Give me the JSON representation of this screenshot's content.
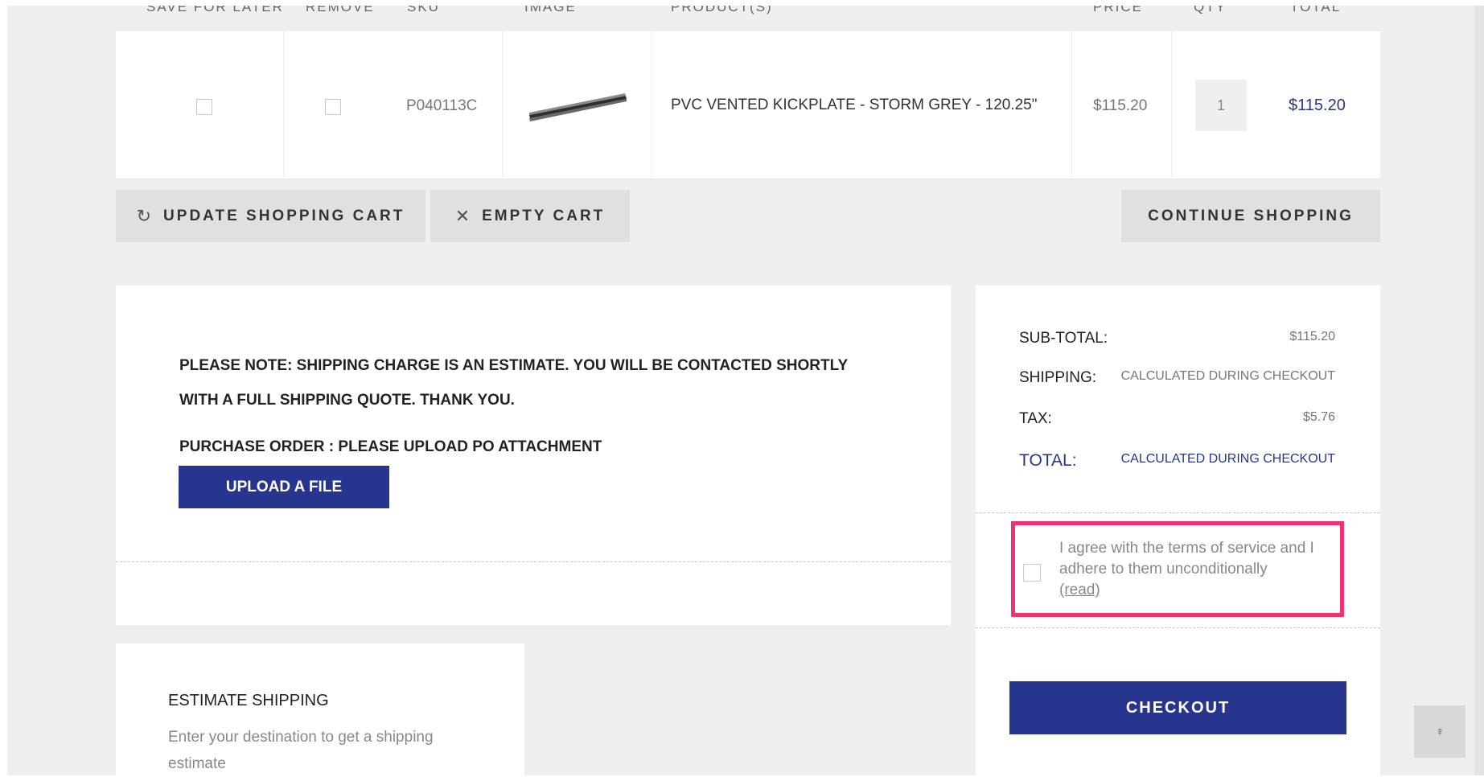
{
  "table": {
    "headers": [
      "SAVE FOR LATER",
      "REMOVE",
      "SKU",
      "IMAGE",
      "PRODUCT(S)",
      "PRICE",
      "QTY",
      "TOTAL"
    ],
    "rows": [
      {
        "sku": "P040113C",
        "image_alt": "kickplate-image",
        "product": "PVC VENTED KICKPLATE - STORM GREY - 120.25\"",
        "price": "$115.20",
        "qty": "1",
        "total": "$115.20"
      }
    ]
  },
  "actions": {
    "update": "UPDATE SHOPPING CART",
    "update_icon": "refresh-icon",
    "empty": "EMPTY CART",
    "empty_icon": "close-icon",
    "continue": "CONTINUE SHOPPING"
  },
  "note": {
    "text": "PLEASE NOTE: SHIPPING CHARGE IS AN ESTIMATE. YOU WILL BE CONTACTED SHORTLY WITH A FULL SHIPPING QUOTE. THANK YOU.",
    "po_label": "PURCHASE ORDER : PLEASE UPLOAD PO ATTACHMENT",
    "upload_button": "UPLOAD A FILE"
  },
  "estimate": {
    "title": "ESTIMATE SHIPPING",
    "subtitle": "Enter your destination to get a shipping estimate"
  },
  "totals": {
    "subtotal_label": "SUB-TOTAL:",
    "subtotal_value": "$115.20",
    "shipping_label": "SHIPPING:",
    "shipping_value": "CALCULATED DURING CHECKOUT",
    "tax_label": "TAX:",
    "tax_value": "$5.76",
    "total_label": "TOTAL:",
    "total_value": "CALCULATED DURING CHECKOUT"
  },
  "terms": {
    "text": "I agree with the terms of service and I adhere to them unconditionally",
    "read_link": "(read)"
  },
  "checkout": "CHECKOUT",
  "back_to_top_icon": "arrow-up-icon",
  "colors": {
    "accent": "#27358f",
    "highlight": "#f0336f",
    "background": "#efefef"
  }
}
